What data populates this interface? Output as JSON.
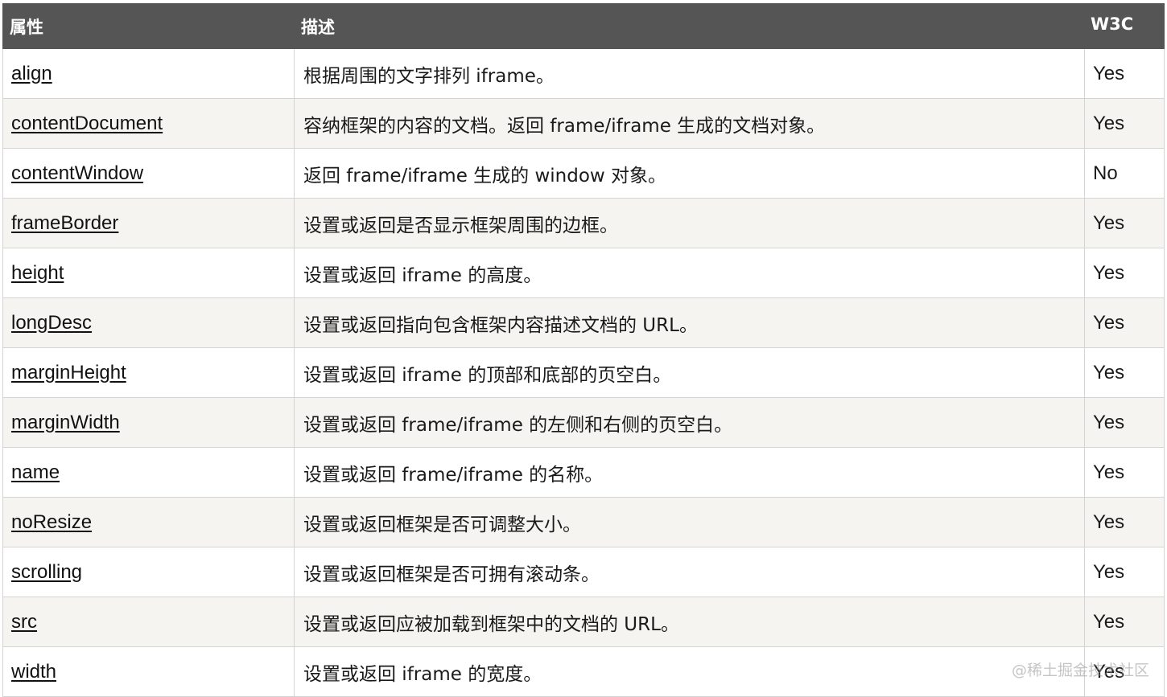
{
  "header": {
    "col_property": "属性",
    "col_description": "描述",
    "col_w3c": "W3C"
  },
  "rows": [
    {
      "property": "align",
      "description": "根据周围的文字排列 iframe。",
      "w3c": "Yes"
    },
    {
      "property": "contentDocument",
      "description": "容纳框架的内容的文档。返回 frame/iframe 生成的文档对象。",
      "w3c": "Yes"
    },
    {
      "property": "contentWindow",
      "description": "返回 frame/iframe 生成的 window 对象。",
      "w3c": "No"
    },
    {
      "property": "frameBorder",
      "description": "设置或返回是否显示框架周围的边框。",
      "w3c": "Yes"
    },
    {
      "property": "height",
      "description": "设置或返回 iframe 的高度。",
      "w3c": "Yes"
    },
    {
      "property": "longDesc",
      "description": "设置或返回指向包含框架内容描述文档的 URL。",
      "w3c": "Yes"
    },
    {
      "property": "marginHeight",
      "description": "设置或返回 iframe 的顶部和底部的页空白。",
      "w3c": "Yes"
    },
    {
      "property": "marginWidth",
      "description": "设置或返回 frame/iframe 的左侧和右侧的页空白。",
      "w3c": "Yes"
    },
    {
      "property": "name",
      "description": "设置或返回 frame/iframe 的名称。",
      "w3c": "Yes"
    },
    {
      "property": "noResize",
      "description": "设置或返回框架是否可调整大小。",
      "w3c": "Yes"
    },
    {
      "property": "scrolling",
      "description": "设置或返回框架是否可拥有滚动条。",
      "w3c": "Yes"
    },
    {
      "property": "src",
      "description": "设置或返回应被加载到框架中的文档的 URL。",
      "w3c": "Yes"
    },
    {
      "property": "width",
      "description": "设置或返回 iframe 的宽度。",
      "w3c": "Yes"
    }
  ],
  "watermark": "@稀土掘金技术社区"
}
